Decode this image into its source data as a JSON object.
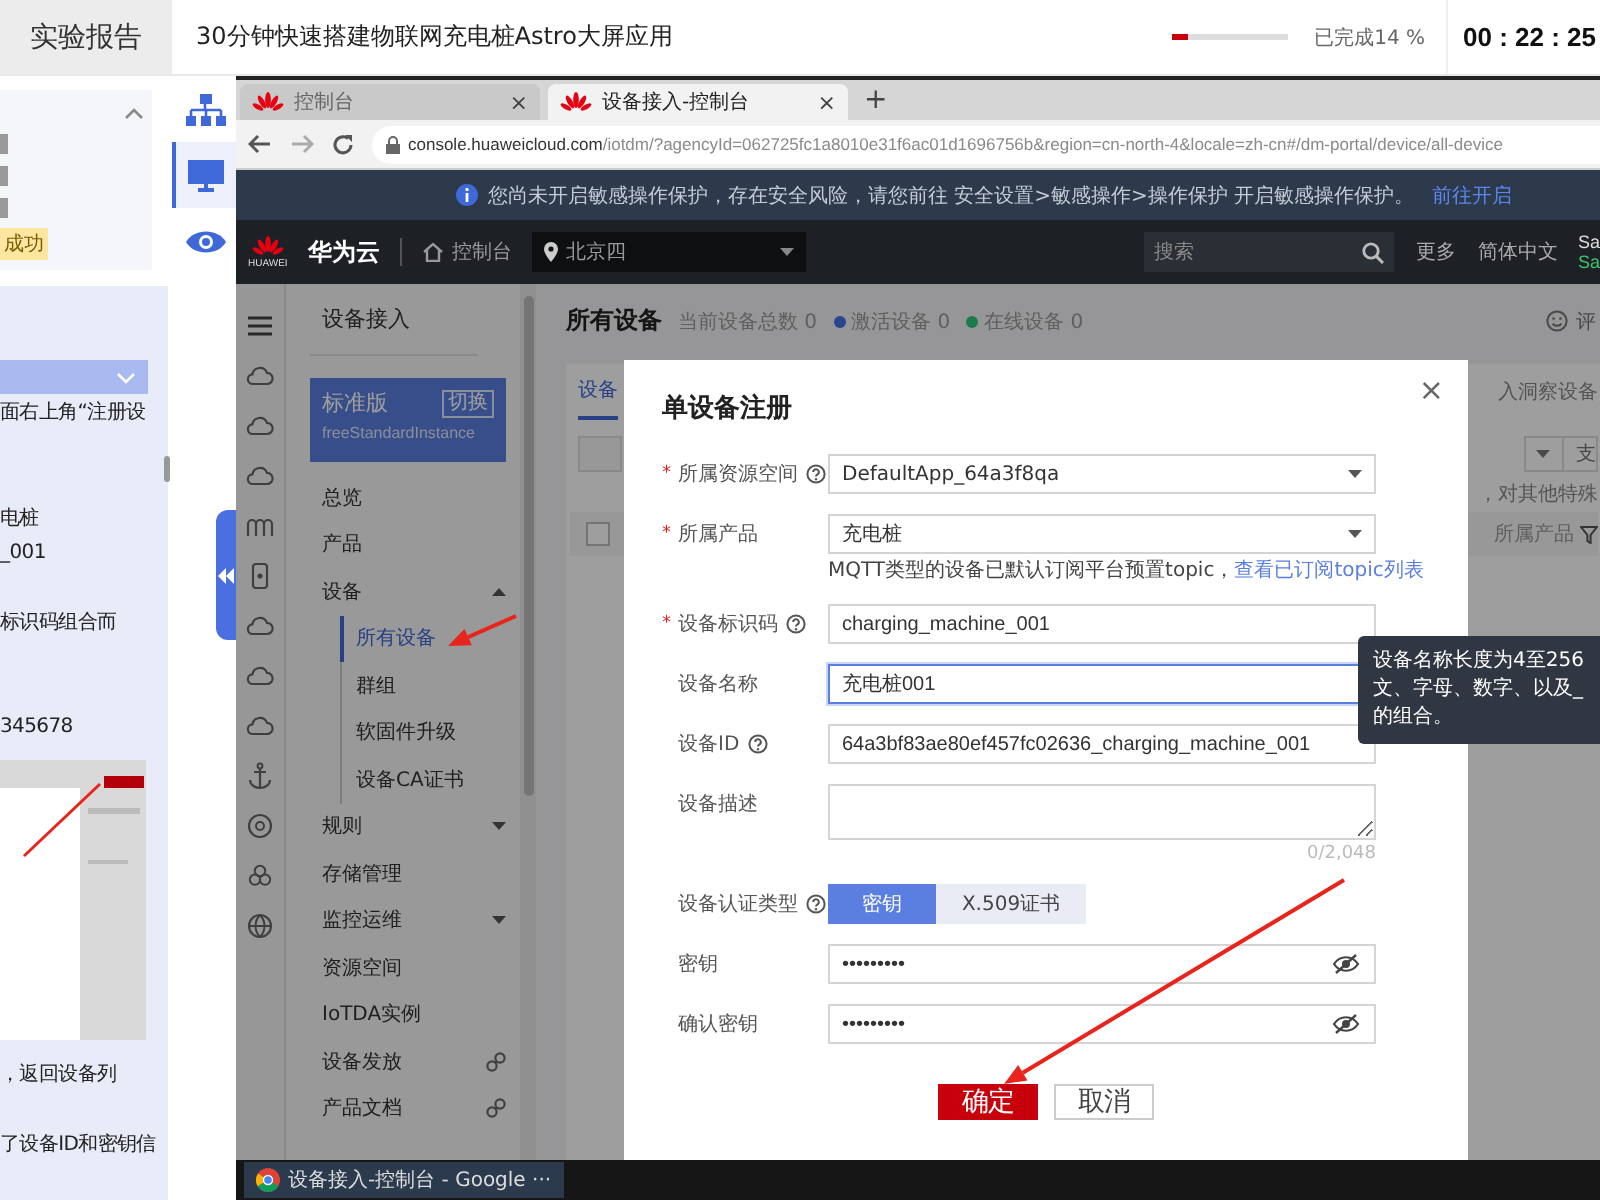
{
  "top_bar": {
    "tab": "实验报告",
    "title": "30分钟快速搭建物联网充电桩Astro大屏应用",
    "progress": {
      "level": 0.14,
      "label": "已完成14 %"
    },
    "timer": "00 : 22 : 25"
  },
  "report_panel": {
    "badge": "成功",
    "lines": [
      "面右上角“注册设",
      "电桩",
      "_001",
      "标识码组合而",
      "345678",
      "，返回设备列",
      "了设备ID和密钥信"
    ]
  },
  "tool_rail": [
    {
      "kind": "tree",
      "selected": false
    },
    {
      "kind": "monitor",
      "selected": true
    },
    {
      "kind": "eye",
      "selected": false
    }
  ],
  "browser": {
    "tabs": [
      {
        "title": "控制台",
        "close": "×",
        "selected": false
      },
      {
        "title": "设备接入-控制台",
        "close": "×",
        "selected": true
      }
    ],
    "new_tab": "+",
    "url_host": "console.huaweicloud.com",
    "url_path": "/iotdm/?agencyId=062725fc1a8010e31f6ac01d1696756b&region=cn-north-4&locale=zh-cn#/dm-portal/device/all-device",
    "notice": {
      "text": "您尚未开启敏感操作保护，存在安全风险，请您前往 安全设置>敏感操作>操作保护 开启敏感操作保护。",
      "link": "前往开启"
    },
    "header": {
      "logo_text": "HUAWEI",
      "brand": "华为云",
      "console": "控制台",
      "region": "北京四",
      "search_placeholder": "搜索",
      "menu": [
        "更多",
        "简体中文"
      ],
      "account": [
        "Sa",
        "Sa"
      ]
    },
    "sidebar": {
      "title": "设备接入",
      "instance": {
        "name": "标准版",
        "switch": "切换",
        "id": "freeStandardInstance"
      },
      "items": [
        {
          "label": "总览",
          "kind": "plain",
          "selected": false
        },
        {
          "label": "产品",
          "kind": "plain",
          "selected": false
        },
        {
          "label": "设备",
          "kind": "group",
          "selected": false,
          "expanded": true,
          "children": [
            {
              "label": "所有设备",
              "selected": true
            },
            {
              "label": "群组",
              "selected": false
            },
            {
              "label": "软固件升级",
              "selected": false
            },
            {
              "label": "设备CA证书",
              "selected": false
            }
          ]
        },
        {
          "label": "规则",
          "kind": "group",
          "selected": false,
          "expanded": false
        },
        {
          "label": "存储管理",
          "kind": "plain",
          "selected": false
        },
        {
          "label": "监控运维",
          "kind": "group",
          "selected": false,
          "expanded": false
        },
        {
          "label": "资源空间",
          "kind": "plain",
          "selected": false
        },
        {
          "label": "IoTDA实例",
          "kind": "plain",
          "selected": false
        },
        {
          "label": "设备发放",
          "kind": "external",
          "selected": false
        },
        {
          "label": "产品文档",
          "kind": "external",
          "selected": false
        }
      ]
    },
    "page": {
      "title": "所有设备",
      "stats": [
        {
          "label": "当前设备总数 0"
        },
        {
          "label": "激活设备 0",
          "color": "#2a4590"
        },
        {
          "label": "在线设备 0",
          "color": "#1c7a4c"
        }
      ],
      "header_checkbox": {
        "checked": false
      },
      "feedback": "评",
      "tab": {
        "label": "设备",
        "selected": true
      },
      "fragments": [
        "入洞察设备",
        "支",
        "，对其他特殊",
        "所属产品"
      ]
    },
    "dialog": {
      "title": "单设备注册",
      "close": "×",
      "required_mark": "*",
      "fields": [
        {
          "label": "所属资源空间",
          "required": true,
          "help": true,
          "kind": "select",
          "value": "DefaultApp_64a3f8qa"
        },
        {
          "label": "所属产品",
          "required": true,
          "help": false,
          "kind": "select",
          "value": "充电桩",
          "hint": "MQTT类型的设备已默认订阅平台预置topic，",
          "hint_link": "查看已订阅topic列表"
        },
        {
          "label": "设备标识码",
          "required": true,
          "help": true,
          "kind": "input",
          "value": "charging_machine_001",
          "focused": false
        },
        {
          "label": "设备名称",
          "required": false,
          "help": false,
          "kind": "input",
          "value": "充电桩001",
          "focused": true
        },
        {
          "label": "设备ID",
          "required": false,
          "help": true,
          "kind": "input",
          "value": "64a3bf83ae80ef457fc02636_charging_machine_001",
          "focused": false
        },
        {
          "label": "设备描述",
          "required": false,
          "help": false,
          "kind": "textarea",
          "counter": "0/2,048"
        },
        {
          "label": "设备认证类型",
          "required": false,
          "help": true,
          "kind": "segmented",
          "options": [
            {
              "label": "密钥",
              "selected": true
            },
            {
              "label": "X.509证书",
              "selected": false
            }
          ]
        },
        {
          "label": "密钥",
          "required": false,
          "help": false,
          "kind": "password",
          "value": "•••••••••"
        },
        {
          "label": "确认密钥",
          "required": false,
          "help": false,
          "kind": "password",
          "value": "•••••••••"
        }
      ],
      "buttons": [
        {
          "label": "确定",
          "kind": "primary"
        },
        {
          "label": "取消",
          "kind": "secondary"
        }
      ]
    },
    "tooltip": {
      "lines": [
        "设备名称长度为4至256",
        "文、字母、数字、以及_",
        "的组合。"
      ]
    },
    "taskbar": {
      "task": "设备接入-控制台 - Google ···"
    }
  }
}
